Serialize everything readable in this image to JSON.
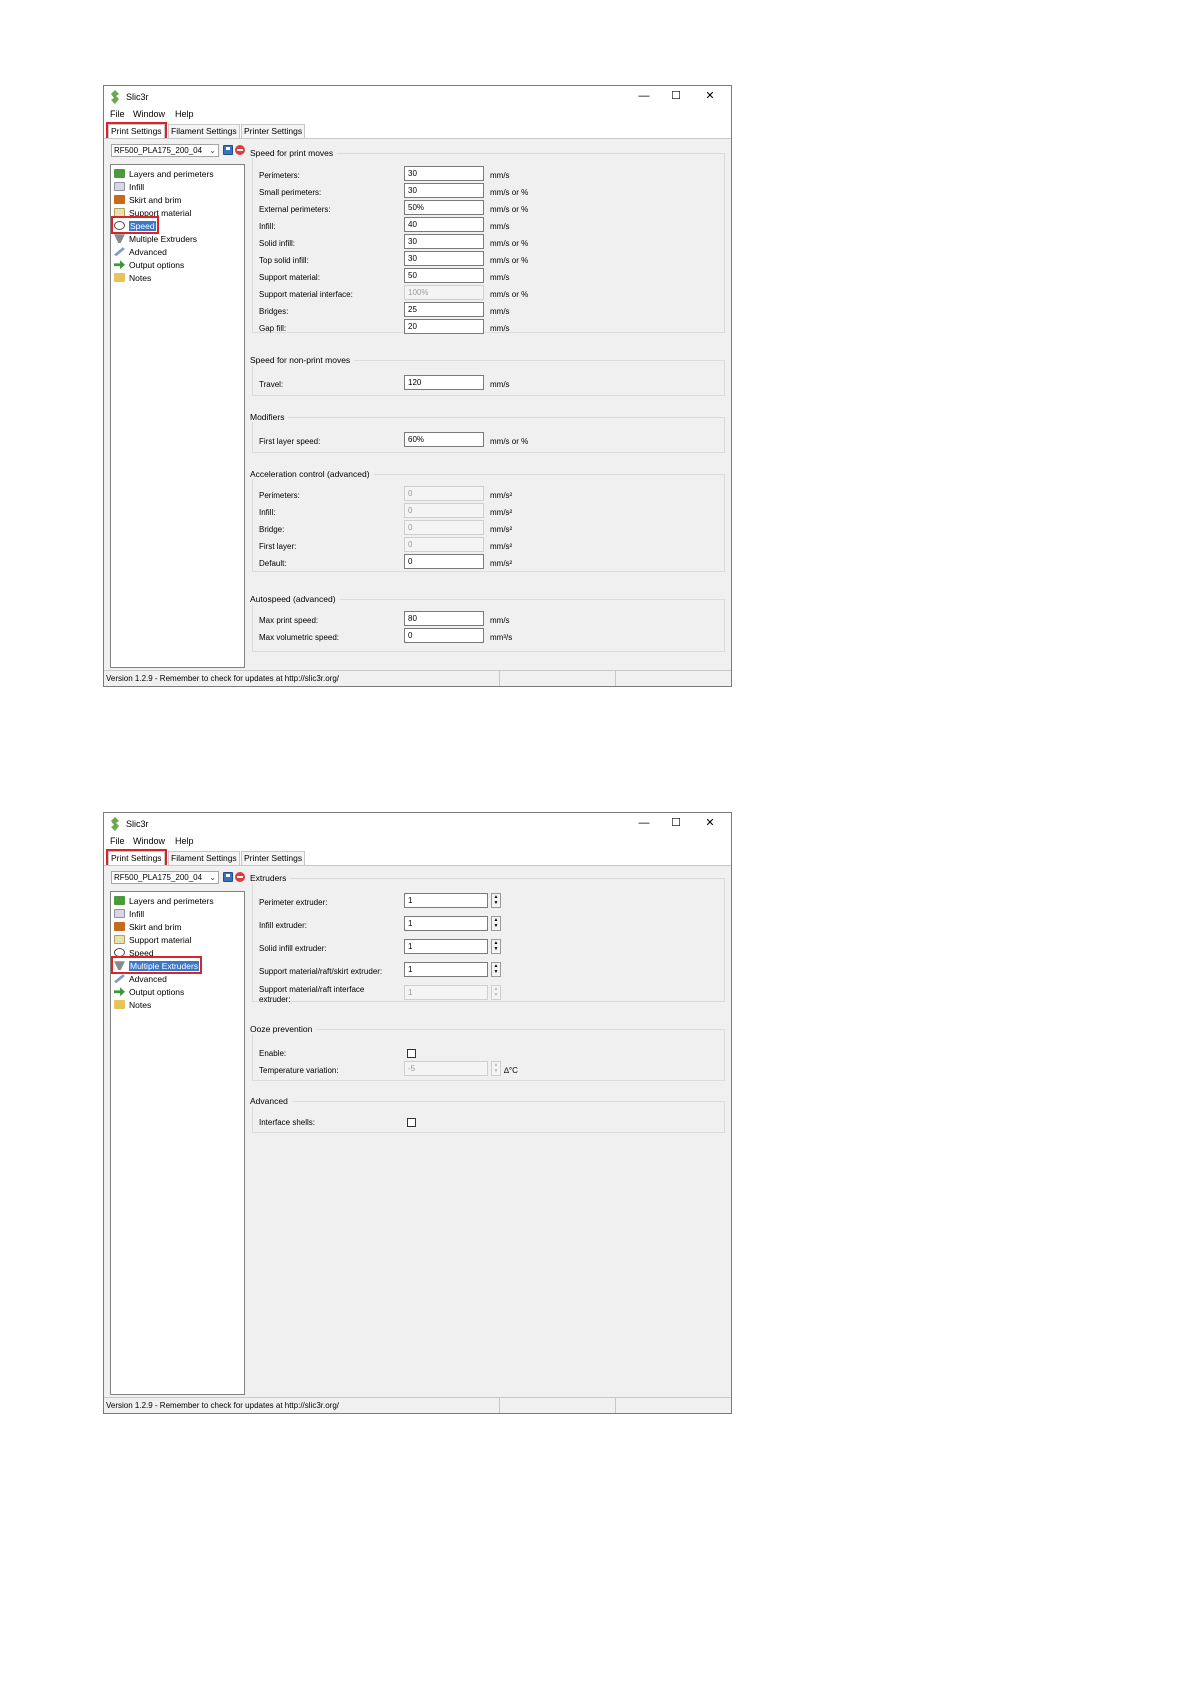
{
  "app": {
    "title": "Slic3r",
    "menu": [
      "File",
      "Window",
      "Help"
    ],
    "tabs": [
      "Print Settings",
      "Filament Settings",
      "Printer Settings"
    ],
    "preset": "RF500_PLA175_200_04",
    "status": "Version 1.2.9 - Remember to check for updates at http://slic3r.org/",
    "highlight_color": "#d6252b",
    "selection_color": "#3a78c9"
  },
  "tree": {
    "items": [
      "Layers and perimeters",
      "Infill",
      "Skirt and brim",
      "Support material",
      "Speed",
      "Multiple Extruders",
      "Advanced",
      "Output options",
      "Notes"
    ],
    "icons": [
      "layers-icon",
      "infill-icon",
      "skirt-brim-icon",
      "support-material-icon",
      "speed-icon",
      "extruders-icon",
      "advanced-icon",
      "output-options-icon",
      "notes-icon"
    ]
  },
  "speed_page": {
    "print_moves": {
      "title": "Speed for print moves",
      "rows": [
        {
          "label": "Perimeters:",
          "value": "30",
          "unit": "mm/s"
        },
        {
          "label": "Small perimeters:",
          "value": "30",
          "unit": "mm/s or %"
        },
        {
          "label": "External perimeters:",
          "value": "50%",
          "unit": "mm/s or %"
        },
        {
          "label": "Infill:",
          "value": "40",
          "unit": "mm/s"
        },
        {
          "label": "Solid infill:",
          "value": "30",
          "unit": "mm/s or %"
        },
        {
          "label": "Top solid infill:",
          "value": "30",
          "unit": "mm/s or %"
        },
        {
          "label": "Support material:",
          "value": "50",
          "unit": "mm/s"
        },
        {
          "label": "Support material interface:",
          "value": "100%",
          "unit": "mm/s or %"
        },
        {
          "label": "Bridges:",
          "value": "25",
          "unit": "mm/s"
        },
        {
          "label": "Gap fill:",
          "value": "20",
          "unit": "mm/s"
        }
      ]
    },
    "non_print": {
      "title": "Speed for non-print moves",
      "rows": [
        {
          "label": "Travel:",
          "value": "120",
          "unit": "mm/s"
        }
      ]
    },
    "modifiers": {
      "title": "Modifiers",
      "rows": [
        {
          "label": "First layer speed:",
          "value": "60%",
          "unit": "mm/s or %"
        }
      ]
    },
    "acceleration": {
      "title": "Acceleration control (advanced)",
      "rows": [
        {
          "label": "Perimeters:",
          "value": "0",
          "unit": "mm/s²"
        },
        {
          "label": "Infill:",
          "value": "0",
          "unit": "mm/s²"
        },
        {
          "label": "Bridge:",
          "value": "0",
          "unit": "mm/s²"
        },
        {
          "label": "First layer:",
          "value": "0",
          "unit": "mm/s²"
        },
        {
          "label": "Default:",
          "value": "0",
          "unit": "mm/s²"
        }
      ]
    },
    "autospeed": {
      "title": "Autospeed (advanced)",
      "rows": [
        {
          "label": "Max print speed:",
          "value": "80",
          "unit": "mm/s"
        },
        {
          "label": "Max volumetric speed:",
          "value": "0",
          "unit": "mm³/s"
        }
      ]
    }
  },
  "extruders_page": {
    "extruders": {
      "title": "Extruders",
      "rows": [
        {
          "label": "Perimeter extruder:",
          "value": "1"
        },
        {
          "label": "Infill extruder:",
          "value": "1"
        },
        {
          "label": "Solid infill extruder:",
          "value": "1"
        },
        {
          "label": "Support material/raft/skirt extruder:",
          "value": "1"
        },
        {
          "label": "Support material/raft interface",
          "label2": "extruder:",
          "value": "1"
        }
      ]
    },
    "ooze": {
      "title": "Ooze prevention",
      "enable_label": "Enable:",
      "temp_label": "Temperature variation:",
      "temp_value": "-5",
      "temp_unit": "∆°C"
    },
    "advanced": {
      "title": "Advanced",
      "interface_label": "Interface shells:"
    }
  }
}
